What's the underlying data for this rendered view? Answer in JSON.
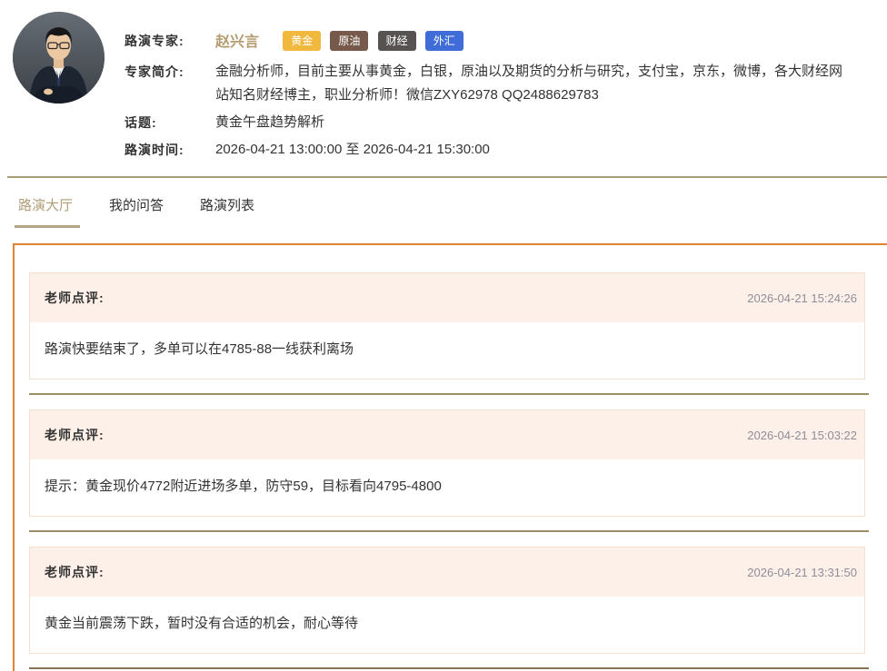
{
  "expert": {
    "labels": {
      "expert": "路演专家:",
      "intro": "专家简介:",
      "topic": "话题:",
      "time": "路演时间:"
    },
    "name": "赵兴言",
    "tags": [
      {
        "label": "黄金",
        "color": "#f0b83d"
      },
      {
        "label": "原油",
        "color": "#77594b"
      },
      {
        "label": "财经",
        "color": "#575350"
      },
      {
        "label": "外汇",
        "color": "#3f6cd6"
      }
    ],
    "intro": "金融分析师，目前主要从事黄金，白银，原油以及期货的分析与研究，支付宝，京东，微博，各大财经网站知名财经博主，职业分析师！微信ZXY62978 QQ2488629783",
    "topic": "黄金午盘趋势解析",
    "time": "2026-04-21 13:00:00 至 2026-04-21 15:30:00"
  },
  "tabs": [
    {
      "label": "路演大厅",
      "active": true
    },
    {
      "label": "我的问答",
      "active": false
    },
    {
      "label": "路演列表",
      "active": false
    }
  ],
  "comments": [
    {
      "title": "老师点评:",
      "time": "2026-04-21 15:24:26",
      "text": "路演快要结束了，多单可以在4785-88一线获利离场"
    },
    {
      "title": "老师点评:",
      "time": "2026-04-21 15:03:22",
      "text": "提示：黄金现价4772附近进场多单，防守59，目标看向4795-4800"
    },
    {
      "title": "老师点评:",
      "time": "2026-04-21 13:31:50",
      "text": "黄金当前震荡下跌，暂时没有合适的机会，耐心等待"
    }
  ],
  "colors": {
    "panel_border": "#de8531",
    "divider_tan": "#a79b78",
    "separator": "#9d8d67",
    "name": "#b49c70",
    "card_header_bg": "#fdf0e8",
    "card_border": "#f6dfcc",
    "timestamp": "#8e8e9a",
    "active_tab": "#b09d78"
  }
}
